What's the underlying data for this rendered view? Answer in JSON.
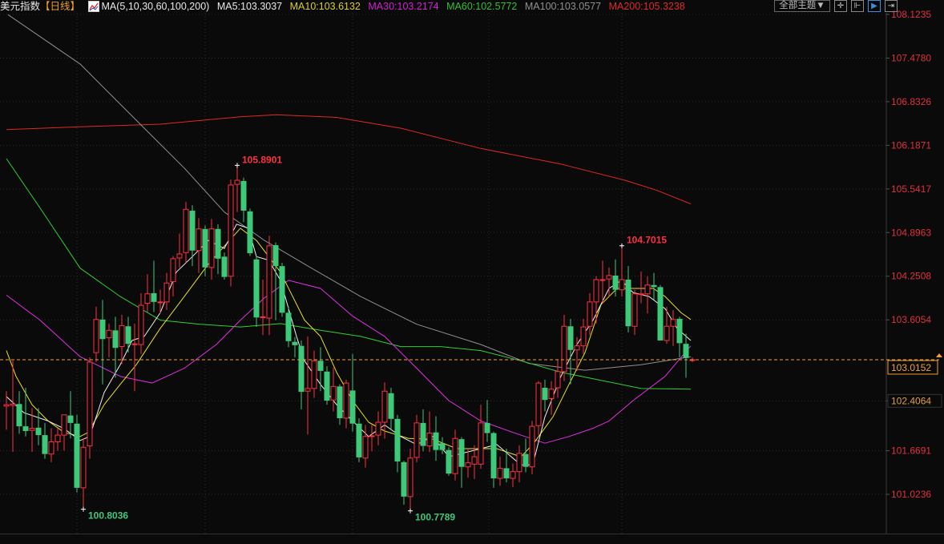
{
  "header": {
    "title": "美元指数",
    "period": "【日线】",
    "ma_params": "MA(5,10,30,60,100,200)",
    "ma5": "MA5:103.3037",
    "ma10": "MA10:103.6132",
    "ma30": "MA30:103.2174",
    "ma60": "MA60:102.5772",
    "ma100": "MA100:103.0577",
    "ma200": "MA200:105.3238",
    "theme_button": "全部主题▼"
  },
  "colors": {
    "up": "#ff3040",
    "down": "#3cc97a",
    "ma5": "#f0f0f0",
    "ma10": "#e8e020",
    "ma30": "#e030e0",
    "ma60": "#30d030",
    "ma100": "#909090",
    "ma200": "#e02828",
    "current": "#f0a030",
    "axis_text": "#e03040"
  },
  "chart_data": {
    "type": "candlestick",
    "title": "美元指数 日线",
    "ylim": [
      100.72,
      108.1235
    ],
    "y_ticks": [
      "108.1235",
      "107.4780",
      "106.8326",
      "106.1871",
      "105.5417",
      "104.8963",
      "104.2508",
      "103.6054",
      "102.4064",
      "101.6691",
      "101.0236"
    ],
    "current_price": "103.0152",
    "annotations": [
      {
        "text": "105.8901",
        "index": 36,
        "price": 105.8901,
        "kind": "high"
      },
      {
        "text": "104.7015",
        "index": 96,
        "price": 104.7015,
        "kind": "high"
      },
      {
        "text": "100.8036",
        "index": 12,
        "price": 100.8036,
        "kind": "low"
      },
      {
        "text": "100.7789",
        "index": 63,
        "price": 100.7789,
        "kind": "low"
      }
    ],
    "ohlc": [
      [
        102.33,
        102.55,
        101.98,
        102.35
      ],
      [
        102.34,
        103.0,
        101.65,
        102.36
      ],
      [
        102.36,
        102.55,
        101.92,
        102.03
      ],
      [
        102.03,
        102.6,
        101.88,
        101.96
      ],
      [
        101.97,
        102.3,
        101.65,
        102.0
      ],
      [
        102.01,
        102.3,
        101.75,
        101.9
      ],
      [
        101.9,
        102.08,
        101.55,
        101.62
      ],
      [
        101.62,
        102.0,
        101.5,
        101.8
      ],
      [
        101.8,
        102.0,
        101.67,
        101.9
      ],
      [
        101.9,
        102.05,
        101.67,
        102.2
      ],
      [
        102.19,
        102.55,
        101.85,
        102.08
      ],
      [
        102.07,
        102.2,
        101.05,
        101.12
      ],
      [
        101.12,
        101.85,
        100.8036,
        101.72
      ],
      [
        101.74,
        103.05,
        101.55,
        102.98
      ],
      [
        103.12,
        103.8,
        102.98,
        103.61
      ],
      [
        103.61,
        103.9,
        102.65,
        103.32
      ],
      [
        103.34,
        103.55,
        103.05,
        103.45
      ],
      [
        103.45,
        103.65,
        102.75,
        103.19
      ],
      [
        103.21,
        103.68,
        102.95,
        103.52
      ],
      [
        103.51,
        103.65,
        103.12,
        103.25
      ],
      [
        103.25,
        103.55,
        102.55,
        103.25
      ],
      [
        103.24,
        104.0,
        103.1,
        103.82
      ],
      [
        103.85,
        104.28,
        103.72,
        103.99
      ],
      [
        104.0,
        104.48,
        103.72,
        103.87
      ],
      [
        103.87,
        104.05,
        103.7,
        103.87
      ],
      [
        103.87,
        104.3,
        103.75,
        104.15
      ],
      [
        104.17,
        104.55,
        103.95,
        104.51
      ],
      [
        104.52,
        104.88,
        104.38,
        104.58
      ],
      [
        104.6,
        105.35,
        104.45,
        105.24
      ],
      [
        105.22,
        105.3,
        104.4,
        104.63
      ],
      [
        104.63,
        105.11,
        104.3,
        104.95
      ],
      [
        104.95,
        105.0,
        104.25,
        104.38
      ],
      [
        104.38,
        105.1,
        104.2,
        104.95
      ],
      [
        104.95,
        105.02,
        104.28,
        104.51
      ],
      [
        104.54,
        104.6,
        104.2,
        104.24
      ],
      [
        104.25,
        105.68,
        104.1,
        105.6
      ],
      [
        105.61,
        105.8901,
        105.2,
        105.67
      ],
      [
        105.66,
        105.71,
        105.05,
        105.22
      ],
      [
        105.21,
        105.25,
        104.55,
        104.59
      ],
      [
        104.5,
        104.55,
        103.5,
        103.64
      ],
      [
        103.64,
        104.2,
        103.38,
        103.65
      ],
      [
        103.63,
        104.85,
        103.38,
        104.7
      ],
      [
        104.71,
        104.75,
        103.6,
        104.4
      ],
      [
        104.4,
        104.45,
        103.65,
        103.71
      ],
      [
        103.71,
        103.8,
        103.2,
        103.29
      ],
      [
        103.28,
        103.35,
        103.05,
        103.23
      ],
      [
        103.22,
        103.3,
        102.28,
        102.54
      ],
      [
        102.55,
        103.36,
        101.91,
        102.59
      ],
      [
        102.59,
        103.15,
        102.45,
        103.0
      ],
      [
        103.0,
        103.2,
        102.55,
        102.85
      ],
      [
        102.84,
        102.92,
        102.35,
        102.41
      ],
      [
        102.42,
        102.9,
        102.25,
        102.62
      ],
      [
        102.62,
        102.65,
        102.05,
        102.15
      ],
      [
        102.15,
        102.72,
        102.0,
        102.67
      ],
      [
        102.56,
        103.1,
        101.95,
        102.07
      ],
      [
        102.07,
        102.15,
        101.5,
        101.57
      ],
      [
        101.56,
        102.05,
        101.42,
        101.88
      ],
      [
        101.89,
        102.05,
        101.66,
        101.89
      ],
      [
        101.9,
        102.25,
        101.75,
        102.09
      ],
      [
        102.09,
        102.68,
        101.85,
        102.55
      ],
      [
        102.52,
        102.6,
        101.97,
        102.14
      ],
      [
        102.14,
        102.2,
        101.35,
        101.51
      ],
      [
        101.5,
        101.52,
        100.87,
        100.99
      ],
      [
        100.99,
        101.7,
        100.7789,
        101.56
      ],
      [
        101.57,
        102.2,
        101.5,
        102.08
      ],
      [
        102.08,
        102.28,
        101.66,
        101.74
      ],
      [
        101.74,
        102.25,
        101.65,
        101.93
      ],
      [
        101.94,
        102.18,
        101.52,
        101.68
      ],
      [
        101.78,
        101.87,
        101.62,
        101.68
      ],
      [
        101.68,
        101.72,
        101.3,
        101.33
      ],
      [
        101.33,
        101.98,
        101.23,
        101.85
      ],
      [
        101.84,
        101.87,
        101.12,
        101.43
      ],
      [
        101.43,
        101.7,
        101.27,
        101.49
      ],
      [
        101.47,
        101.75,
        101.25,
        101.58
      ],
      [
        101.47,
        102.35,
        101.4,
        102.08
      ],
      [
        102.08,
        102.42,
        101.8,
        101.93
      ],
      [
        101.93,
        101.95,
        101.12,
        101.26
      ],
      [
        101.26,
        101.58,
        101.15,
        101.41
      ],
      [
        101.41,
        101.7,
        101.2,
        101.26
      ],
      [
        101.26,
        101.48,
        101.13,
        101.36
      ],
      [
        101.36,
        101.75,
        101.2,
        101.63
      ],
      [
        101.62,
        101.85,
        101.35,
        101.43
      ],
      [
        101.43,
        102.11,
        101.32,
        102.03
      ],
      [
        102.04,
        102.7,
        101.9,
        102.67
      ],
      [
        102.6,
        102.72,
        102.25,
        102.42
      ],
      [
        102.44,
        102.7,
        102.2,
        102.58
      ],
      [
        102.6,
        103.02,
        102.45,
        102.84
      ],
      [
        102.84,
        103.68,
        102.7,
        103.51
      ],
      [
        103.51,
        103.62,
        102.65,
        103.16
      ],
      [
        103.16,
        103.35,
        102.85,
        103.22
      ],
      [
        103.22,
        103.62,
        103.1,
        103.5
      ],
      [
        103.51,
        104.0,
        103.38,
        103.87
      ],
      [
        103.87,
        104.25,
        103.55,
        104.2
      ],
      [
        104.2,
        104.48,
        103.85,
        104.2
      ],
      [
        104.21,
        104.38,
        103.95,
        104.26
      ],
      [
        104.26,
        104.5,
        103.95,
        104.05
      ],
      [
        104.05,
        104.7015,
        103.95,
        104.2
      ],
      [
        104.2,
        104.4,
        103.42,
        103.51
      ],
      [
        103.51,
        104.05,
        103.38,
        103.99
      ],
      [
        103.99,
        104.32,
        103.85,
        103.99
      ],
      [
        103.99,
        104.25,
        103.7,
        104.12
      ],
      [
        104.12,
        104.3,
        103.9,
        104.09
      ],
      [
        104.09,
        104.12,
        103.3,
        103.3
      ],
      [
        103.3,
        103.8,
        103.25,
        103.51
      ],
      [
        103.51,
        103.75,
        103.22,
        103.61
      ],
      [
        103.62,
        103.65,
        103.05,
        103.26
      ],
      [
        103.25,
        103.4,
        102.75,
        103.04
      ],
      [
        103.01,
        103.05,
        102.98,
        103.0152
      ]
    ],
    "ma": {
      "ma200": [
        [
          0,
          106.42
        ],
        [
          11.5,
          106.46
        ],
        [
          24,
          106.5
        ],
        [
          36.5,
          106.61
        ],
        [
          42.1,
          106.64
        ],
        [
          51.5,
          106.6
        ],
        [
          61.5,
          106.44
        ],
        [
          74,
          106.14
        ],
        [
          86.5,
          105.91
        ],
        [
          96.5,
          105.67
        ],
        [
          101.5,
          105.52
        ],
        [
          106.75,
          105.32
        ]
      ],
      "ma100": [
        [
          0.25,
          108.12
        ],
        [
          11.5,
          107.39
        ],
        [
          21.5,
          106.44
        ],
        [
          27.75,
          105.85
        ],
        [
          34,
          105.2
        ],
        [
          40.25,
          104.78
        ],
        [
          46.5,
          104.43
        ],
        [
          55.25,
          103.95
        ],
        [
          64,
          103.54
        ],
        [
          74,
          103.24
        ],
        [
          81.5,
          102.96
        ],
        [
          90.25,
          102.86
        ],
        [
          99,
          102.94
        ],
        [
          106.75,
          103.06
        ]
      ],
      "ma60": [
        [
          0,
          105.99
        ],
        [
          5.25,
          105.26
        ],
        [
          11.5,
          104.37
        ],
        [
          17.75,
          103.95
        ],
        [
          24,
          103.6
        ],
        [
          30.25,
          103.54
        ],
        [
          36.5,
          103.5
        ],
        [
          42.75,
          103.55
        ],
        [
          49,
          103.45
        ],
        [
          55.25,
          103.36
        ],
        [
          61.5,
          103.21
        ],
        [
          67.75,
          103.21
        ],
        [
          74,
          103.15
        ],
        [
          80.25,
          103.0
        ],
        [
          86.5,
          102.83
        ],
        [
          92.75,
          102.71
        ],
        [
          99,
          102.59
        ],
        [
          106.75,
          102.58
        ]
      ],
      "ma30": [
        [
          0,
          103.97
        ],
        [
          5.25,
          103.6
        ],
        [
          11.5,
          103.06
        ],
        [
          17.75,
          102.77
        ],
        [
          22.75,
          102.67
        ],
        [
          27.75,
          102.89
        ],
        [
          32.75,
          103.24
        ],
        [
          36.5,
          103.6
        ],
        [
          40.25,
          103.93
        ],
        [
          44,
          104.19
        ],
        [
          49,
          104.07
        ],
        [
          54,
          103.66
        ],
        [
          59,
          103.36
        ],
        [
          64,
          102.89
        ],
        [
          69,
          102.41
        ],
        [
          74,
          102.11
        ],
        [
          79,
          101.94
        ],
        [
          84,
          101.78
        ],
        [
          87.75,
          101.88
        ],
        [
          91.5,
          102.0
        ],
        [
          94,
          102.11
        ],
        [
          97.75,
          102.41
        ],
        [
          102.75,
          102.77
        ],
        [
          106.75,
          103.22
        ]
      ],
      "ma10": [
        [
          0,
          103.15
        ],
        [
          1.5,
          102.77
        ],
        [
          4,
          102.35
        ],
        [
          6.5,
          102.11
        ],
        [
          9,
          101.94
        ],
        [
          11.5,
          101.88
        ],
        [
          12.75,
          101.94
        ],
        [
          15.25,
          102.35
        ],
        [
          17.75,
          102.65
        ],
        [
          20.25,
          102.94
        ],
        [
          24,
          103.48
        ],
        [
          27.75,
          103.95
        ],
        [
          31.5,
          104.43
        ],
        [
          36.5,
          104.96
        ],
        [
          39,
          104.78
        ],
        [
          42.75,
          104.31
        ],
        [
          46.5,
          103.6
        ],
        [
          49,
          103.36
        ],
        [
          51.5,
          102.83
        ],
        [
          54,
          102.41
        ],
        [
          56.5,
          102.09
        ],
        [
          59,
          101.96
        ],
        [
          62.75,
          101.85
        ],
        [
          66.5,
          101.84
        ],
        [
          70.25,
          101.7
        ],
        [
          74,
          101.7
        ],
        [
          76.5,
          101.7
        ],
        [
          80.25,
          101.58
        ],
        [
          82.1,
          101.76
        ],
        [
          85.25,
          102.17
        ],
        [
          87.75,
          102.65
        ],
        [
          90.25,
          103.12
        ],
        [
          92.75,
          103.83
        ],
        [
          95.25,
          104.07
        ],
        [
          99,
          104.07
        ],
        [
          100.9,
          104.07
        ],
        [
          102.75,
          103.95
        ],
        [
          105.25,
          103.71
        ],
        [
          106.75,
          103.61
        ]
      ],
      "ma5": [
        [
          0,
          102.47
        ],
        [
          2.75,
          102.23
        ],
        [
          6.5,
          102.11
        ],
        [
          9,
          101.996
        ],
        [
          11.5,
          101.82
        ],
        [
          13,
          101.88
        ],
        [
          15.25,
          102.53
        ],
        [
          17.75,
          102.94
        ],
        [
          19.6,
          103.3
        ],
        [
          21.5,
          103.36
        ],
        [
          24,
          103.71
        ],
        [
          26.5,
          104.31
        ],
        [
          29,
          104.54
        ],
        [
          31.5,
          104.78
        ],
        [
          34,
          104.66
        ],
        [
          35.9,
          105.02
        ],
        [
          37.75,
          104.96
        ],
        [
          39,
          104.54
        ],
        [
          40.9,
          104.49
        ],
        [
          42.75,
          104.19
        ],
        [
          45.25,
          103.36
        ],
        [
          46.5,
          103.0
        ],
        [
          49,
          102.65
        ],
        [
          51.5,
          102.35
        ],
        [
          54,
          102.11
        ],
        [
          56.5,
          101.88
        ],
        [
          59,
          102.05
        ],
        [
          61.5,
          101.88
        ],
        [
          64,
          101.76
        ],
        [
          66.5,
          101.88
        ],
        [
          69,
          101.58
        ],
        [
          71.5,
          101.64
        ],
        [
          74,
          101.7
        ],
        [
          76.5,
          101.76
        ],
        [
          80.25,
          101.46
        ],
        [
          82.1,
          101.46
        ],
        [
          84,
          102.17
        ],
        [
          86.5,
          102.77
        ],
        [
          89,
          103.24
        ],
        [
          91.5,
          103.6
        ],
        [
          94,
          104.07
        ],
        [
          95.9,
          104.19
        ],
        [
          97.75,
          104.01
        ],
        [
          100.25,
          103.95
        ],
        [
          102.75,
          103.77
        ],
        [
          104.6,
          103.48
        ],
        [
          106.75,
          103.3
        ]
      ]
    }
  }
}
